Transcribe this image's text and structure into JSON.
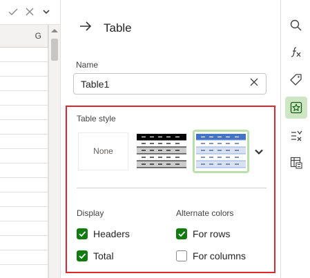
{
  "sheet": {
    "column_header": "G",
    "formula_icons": [
      "check-icon",
      "x-icon",
      "chevron-down-icon"
    ]
  },
  "pane": {
    "title": "Table",
    "name_label": "Name",
    "name_value": "Table1",
    "table_style": {
      "label": "Table style",
      "options": [
        {
          "name": "None",
          "label": "None"
        },
        {
          "name": "black-bands",
          "label": ""
        },
        {
          "name": "blue-bands",
          "label": "",
          "selected": true
        }
      ]
    },
    "display": {
      "label": "Display",
      "headers": {
        "label": "Headers",
        "checked": true
      },
      "total": {
        "label": "Total",
        "checked": true
      }
    },
    "alternate_colors": {
      "label": "Alternate colors",
      "rows": {
        "label": "For rows",
        "checked": true
      },
      "columns": {
        "label": "For columns",
        "checked": false
      }
    }
  },
  "rail": {
    "items": [
      "search-icon",
      "function-icon",
      "tag-icon",
      "star-icon",
      "check-list-icon",
      "table-calc-icon"
    ],
    "active": "star-icon"
  },
  "colors": {
    "accent_green": "#107c10",
    "highlight_red": "#e0262a",
    "selected_style_border": "#b9dfab",
    "blue_header": "#4472c4"
  }
}
